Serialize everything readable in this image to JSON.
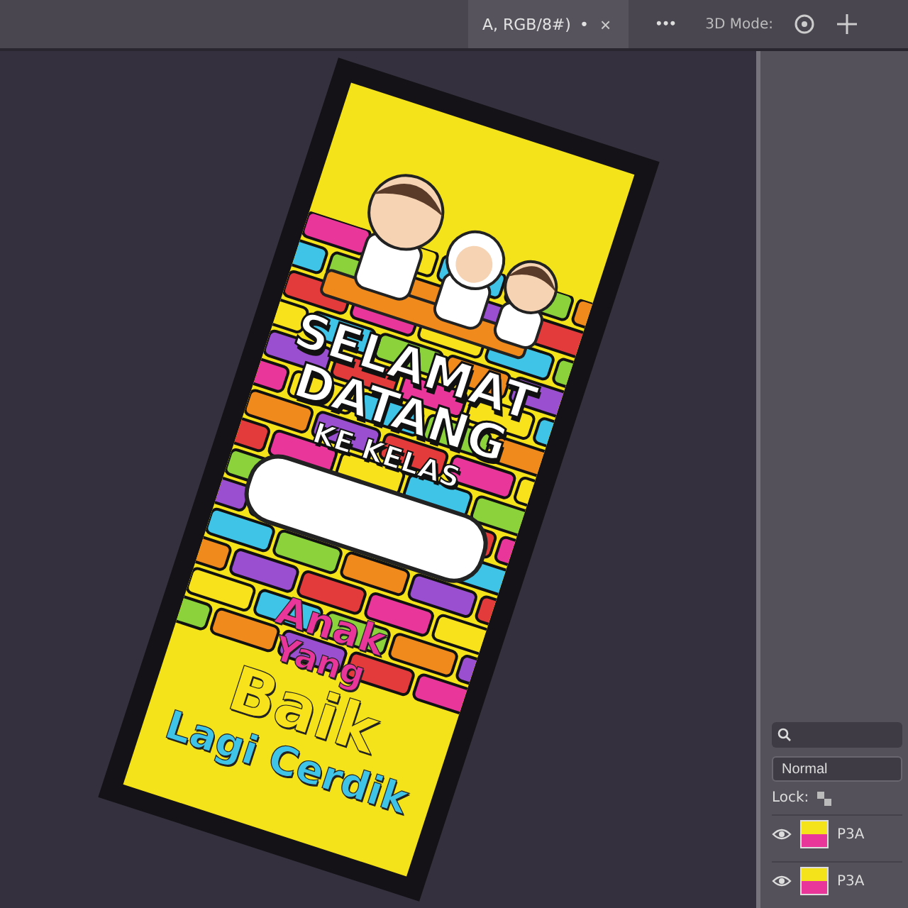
{
  "document_tab": {
    "title": "A, RGB/8#)",
    "modified_mark": "•",
    "close": "×"
  },
  "options_bar": {
    "more": "•••",
    "mode_label": "3D Mode:"
  },
  "banner": {
    "heading": [
      "SELAMAT",
      "DATANG"
    ],
    "subheading": "KE KELAS",
    "slogan": [
      {
        "text": "Anak",
        "color": "#e8369b"
      },
      {
        "text": "Yang",
        "color": "#e8369b"
      },
      {
        "text": "Baik",
        "color": "#f7e21b"
      },
      {
        "text": "Lagi Cerdik",
        "color": "#3fc4e8"
      }
    ]
  },
  "layers_panel": {
    "blend_mode": "Normal",
    "lock_label": "Lock:",
    "layers": [
      {
        "name": "P3A",
        "visible": true
      },
      {
        "name": "P3A",
        "visible": true
      }
    ]
  }
}
